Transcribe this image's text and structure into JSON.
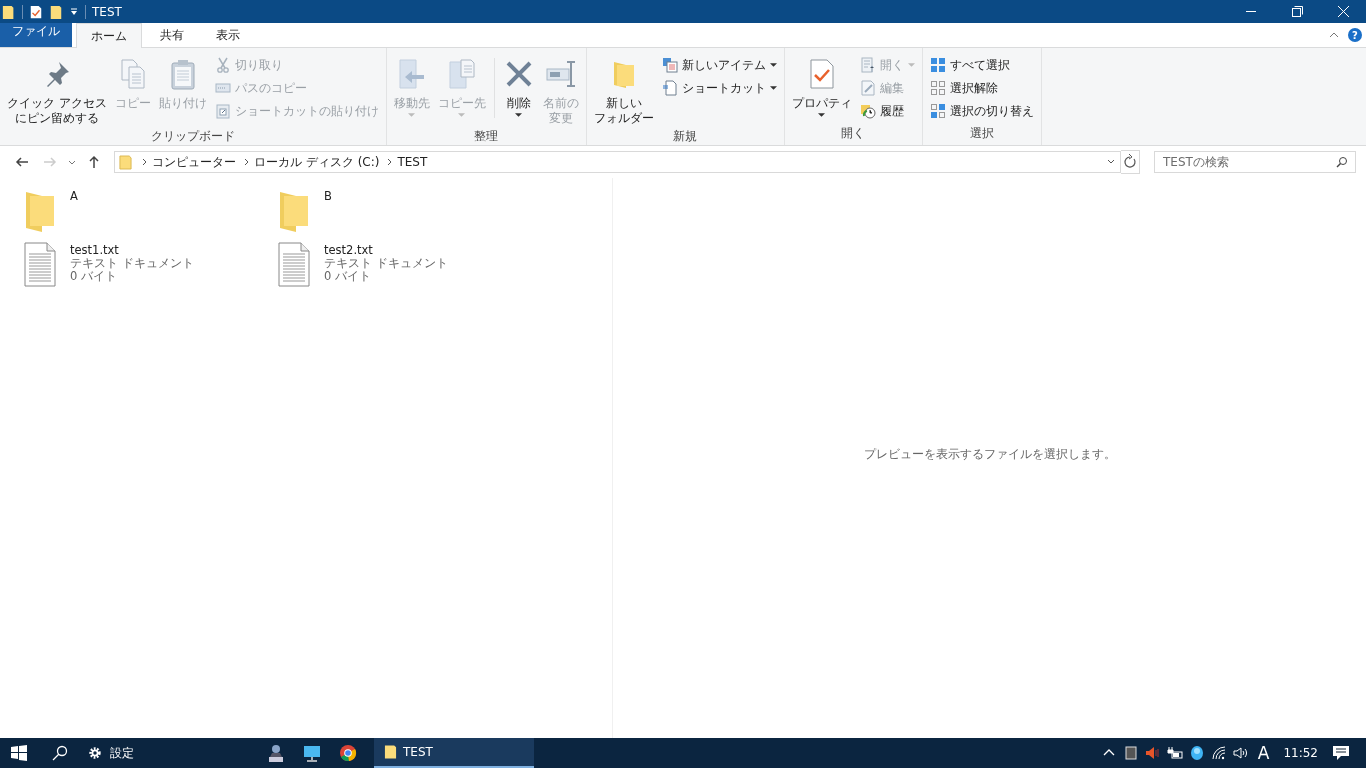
{
  "window": {
    "title": "TEST"
  },
  "ribbon": {
    "tabs": [
      {
        "label": "ファイル",
        "kind": "file",
        "selected": false
      },
      {
        "label": "ホーム",
        "kind": "tab",
        "selected": true
      },
      {
        "label": "共有",
        "kind": "tab",
        "selected": false
      },
      {
        "label": "表示",
        "kind": "tab",
        "selected": false
      }
    ],
    "help": "?",
    "groups": [
      {
        "label": "クリップボード",
        "columns": [
          {
            "kind": "large",
            "items": [
              {
                "lines": [
                  "クイック アクセス",
                  "にピン留めする"
                ],
                "disabled": false,
                "dropdown": false
              }
            ]
          },
          {
            "kind": "large",
            "items": [
              {
                "lines": [
                  "コピー"
                ],
                "disabled": true,
                "dropdown": false
              }
            ]
          },
          {
            "kind": "large",
            "items": [
              {
                "lines": [
                  "貼り付け"
                ],
                "disabled": true,
                "dropdown": false
              }
            ]
          },
          {
            "kind": "small",
            "items": [
              {
                "label": "切り取り",
                "disabled": true,
                "dropdown": false
              },
              {
                "label": "パスのコピー",
                "disabled": true,
                "dropdown": false
              },
              {
                "label": "ショートカットの貼り付け",
                "disabled": true,
                "dropdown": false
              }
            ]
          }
        ]
      },
      {
        "label": "整理",
        "columns": [
          {
            "kind": "large",
            "items": [
              {
                "lines": [
                  "移動先"
                ],
                "disabled": true,
                "dropdown": true
              }
            ]
          },
          {
            "kind": "large",
            "items": [
              {
                "lines": [
                  "コピー先"
                ],
                "disabled": true,
                "dropdown": true
              }
            ]
          },
          {
            "kind": "large",
            "items": [
              {
                "lines": [
                  "削除"
                ],
                "disabled": false,
                "dropdown": true
              }
            ]
          },
          {
            "kind": "large",
            "items": [
              {
                "lines": [
                  "名前の",
                  "変更"
                ],
                "disabled": true,
                "dropdown": false
              }
            ]
          }
        ]
      },
      {
        "label": "新規",
        "columns": [
          {
            "kind": "large",
            "items": [
              {
                "lines": [
                  "新しい",
                  "フォルダー"
                ],
                "disabled": false,
                "dropdown": false
              }
            ]
          },
          {
            "kind": "small",
            "items": [
              {
                "label": "新しいアイテム",
                "disabled": false,
                "dropdown": true
              },
              {
                "label": "ショートカット",
                "disabled": false,
                "dropdown": true
              }
            ]
          }
        ]
      },
      {
        "label": "開く",
        "columns": [
          {
            "kind": "large",
            "items": [
              {
                "lines": [
                  "プロパティ"
                ],
                "disabled": false,
                "dropdown": true
              }
            ]
          },
          {
            "kind": "small",
            "items": [
              {
                "label": "開く",
                "disabled": true,
                "dropdown": true
              },
              {
                "label": "編集",
                "disabled": true,
                "dropdown": false
              },
              {
                "label": "履歴",
                "disabled": false,
                "dropdown": false
              }
            ]
          }
        ]
      },
      {
        "label": "選択",
        "columns": [
          {
            "kind": "small",
            "items": [
              {
                "label": "すべて選択",
                "disabled": false,
                "dropdown": false
              },
              {
                "label": "選択解除",
                "disabled": false,
                "dropdown": false
              },
              {
                "label": "選択の切り替え",
                "disabled": false,
                "dropdown": false
              }
            ]
          }
        ]
      }
    ]
  },
  "navigation": {
    "back_disabled": false,
    "forward_disabled": true,
    "breadcrumbs": [
      "コンピューター",
      "ローカル ディスク (C:)",
      "TEST"
    ],
    "search": {
      "placeholder": "TESTの検索"
    }
  },
  "files": [
    {
      "kind": "folder",
      "name": "A"
    },
    {
      "kind": "folder",
      "name": "B"
    },
    {
      "kind": "text",
      "name": "test1.txt",
      "type": "テキスト ドキュメント",
      "size": "0 バイト"
    },
    {
      "kind": "text",
      "name": "test2.txt",
      "type": "テキスト ドキュメント",
      "size": "0 バイト"
    }
  ],
  "preview": {
    "message": "プレビューを表示するファイルを選択します。"
  },
  "taskbar": {
    "settings": "設定",
    "windows": [
      {
        "label": "TEST",
        "selected": true
      }
    ],
    "ime": "A",
    "time": "11:52"
  }
}
